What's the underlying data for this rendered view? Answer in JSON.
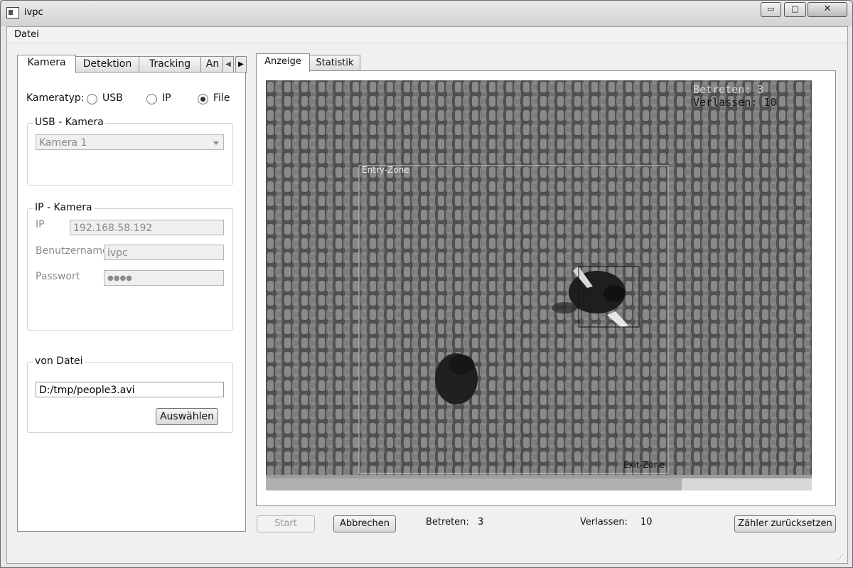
{
  "window": {
    "title": "ivpc",
    "minimize": "▭",
    "maximize": "□",
    "close": "✕"
  },
  "menu": [
    "Datei"
  ],
  "left_tabs": [
    "Kamera",
    "Detektion",
    "Tracking",
    "An"
  ],
  "camera": {
    "type_label": "Kameratyp:",
    "options": [
      "USB",
      "IP",
      "File"
    ],
    "selected": "File",
    "usb_group": "USB - Kamera",
    "usb_combo_value": "Kamera 1",
    "ip_group": "IP - Kamera",
    "ip_label": "IP",
    "ip_value": "192.168.58.192",
    "user_label": "Benutzername",
    "user_value": "ivpc",
    "pass_label": "Passwort",
    "pass_value": "●●●●",
    "file_group": "von Datei",
    "file_value": "D:/tmp/people3.avi",
    "choose_button": "Auswählen"
  },
  "right_tabs": [
    "Anzeige",
    "Statistik"
  ],
  "video": {
    "overlay_line1": "Betreten: 3",
    "overlay_line2": "Verlassen: 10",
    "entry_zone": "Entry-Zone",
    "exit_zone": "Exit-Zone"
  },
  "bottom": {
    "start_button": "Start",
    "cancel_button": "Abbrechen",
    "entered_label": "Betreten:",
    "entered_value": "3",
    "left_label": "Verlassen:",
    "left_value": "10",
    "reset_button": "Zähler zurücksetzen"
  }
}
